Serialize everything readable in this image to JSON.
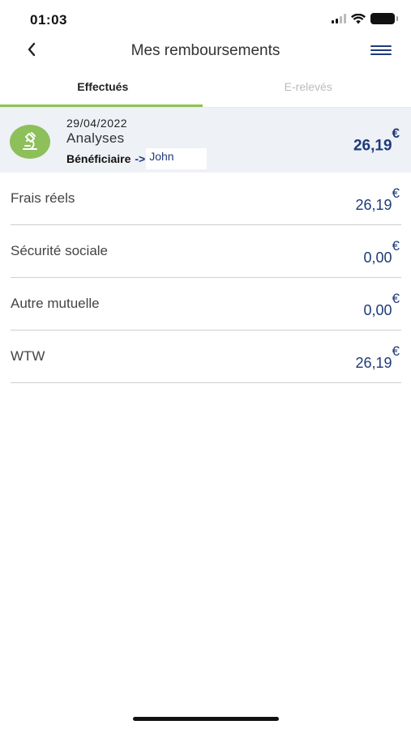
{
  "status": {
    "time": "01:03"
  },
  "header": {
    "title": "Mes remboursements"
  },
  "tabs": [
    {
      "label": "Effectués",
      "active": true
    },
    {
      "label": "E-relevés",
      "active": false
    }
  ],
  "summary": {
    "date": "29/04/2022",
    "act": "Analyses",
    "beneficiary_label": "Bénéficiaire",
    "beneficiary_arrow": "->",
    "beneficiary_name": "John",
    "amount": "26,19",
    "currency": "€",
    "icon": "microscope-icon"
  },
  "rows": [
    {
      "label": "Frais réels",
      "amount": "26,19",
      "currency": "€"
    },
    {
      "label": "Sécurité sociale",
      "amount": "0,00",
      "currency": "€"
    },
    {
      "label": "Autre mutuelle",
      "amount": "0,00",
      "currency": "€"
    },
    {
      "label": "WTW",
      "amount": "26,19",
      "currency": "€"
    }
  ],
  "colors": {
    "accent_green": "#8dc44f",
    "brand_navy": "#1e3a78",
    "summary_bg": "#eef1f6"
  }
}
